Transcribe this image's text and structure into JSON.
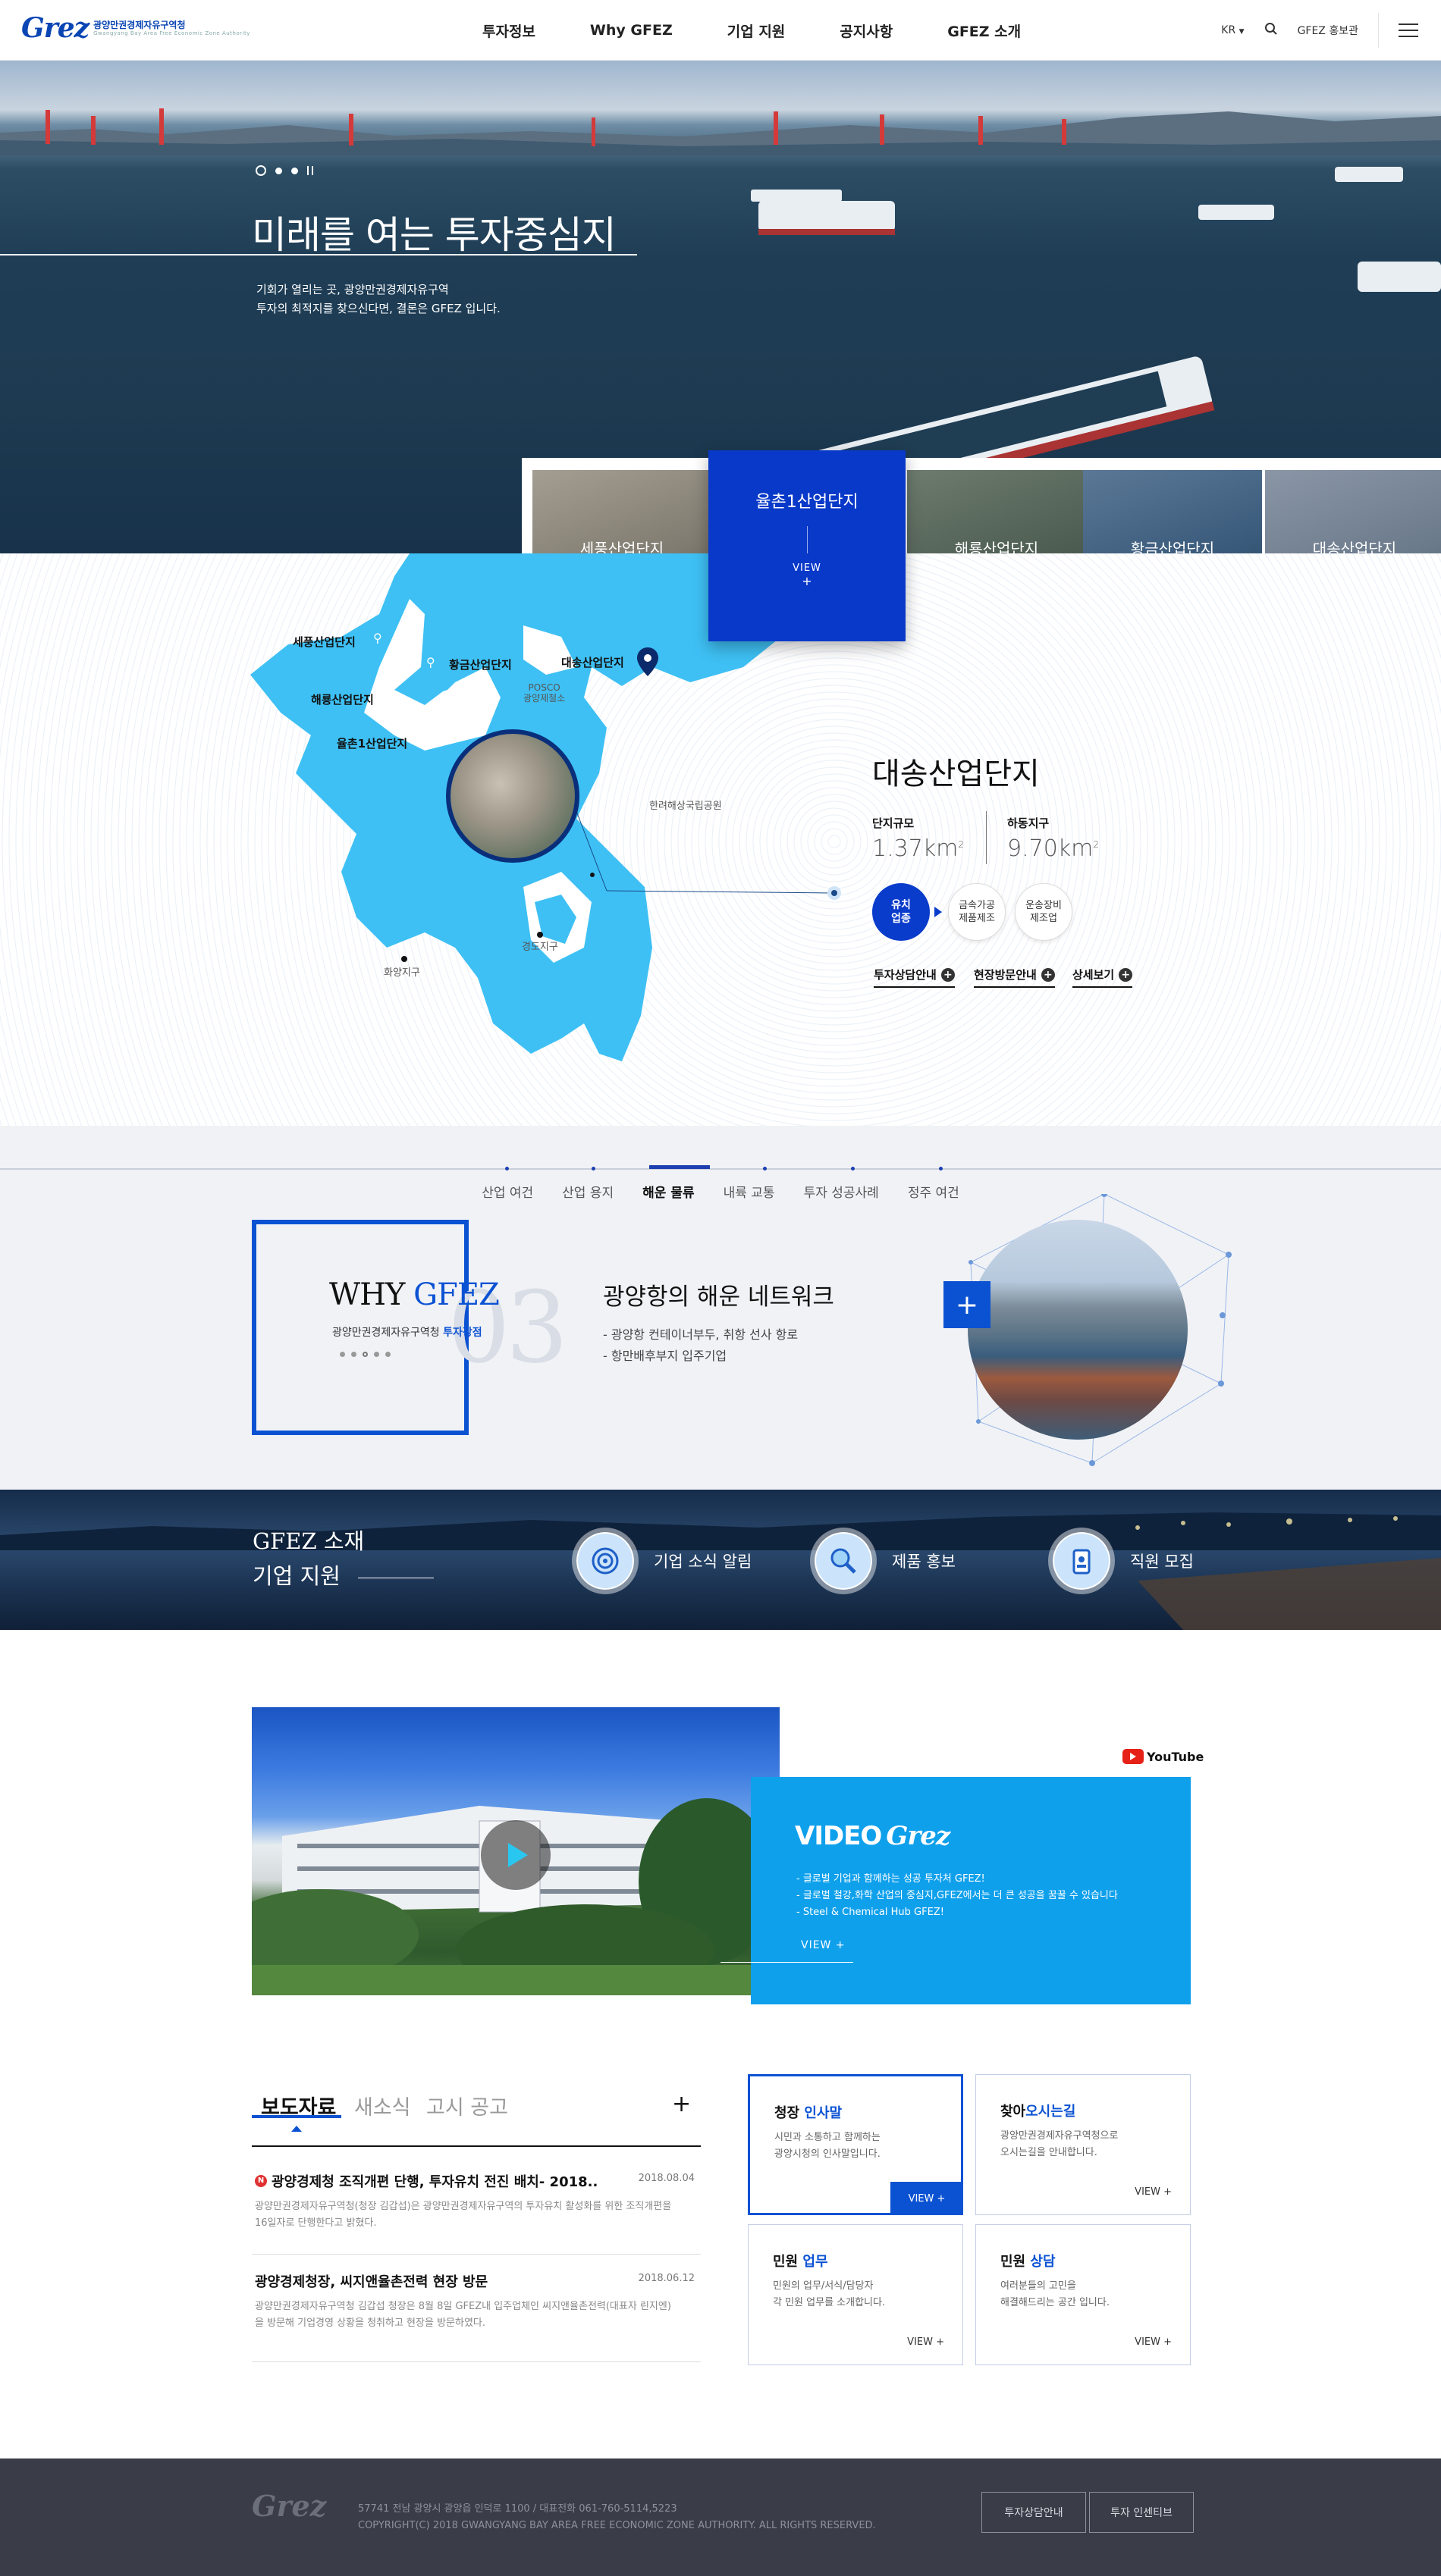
{
  "header": {
    "logo_word": "Grez",
    "logo_org": "광양만권경제자유구역청",
    "logo_org_en": "Gwangyang Bay Area Free Economic Zone Authority",
    "nav": [
      "투자정보",
      "Why GFEZ",
      "기업 지원",
      "공지사항",
      "GFEZ 소개"
    ],
    "lang": "KR",
    "pr_hall": "GFEZ 홍보관"
  },
  "hero": {
    "title": "미래를 여는 투자중심지",
    "desc_line1": "기회가 열리는 곳, 광양만권경제자유구역",
    "desc_line2": "투자의 최적지를 찾으신다면, 결론은 GFEZ 입니다."
  },
  "complexes": {
    "items": [
      "세풍산업단지",
      "율촌1산업단지",
      "해룡산업단지",
      "황금산업단지",
      "대송산업단지"
    ],
    "active_index": 1,
    "view_label": "VIEW",
    "view_plus": "+"
  },
  "map": {
    "pins": {
      "sepung": "세풍산업단지",
      "hwanggeum": "황금산업단지",
      "daesong": "대송산업단지",
      "haeryong": "해룡산업단지",
      "yulchon": "율촌1산업단지",
      "posco": "POSCO\n광양제철소",
      "hallyeo": "한려해상국립공원",
      "gwangyang": "화양지구",
      "gyeongdo": "경도지구"
    },
    "detail": {
      "title": "대송산업단지",
      "size_label": "단지규모",
      "size_value": "1.37km",
      "size_unit": "2",
      "dong_label": "하동지구",
      "dong_value": "9.70km",
      "dong_unit": "2",
      "main_industry": "유치\n업종",
      "industries": [
        "금속가공\n제품제조",
        "운송장비\n제조업"
      ],
      "links": [
        "투자상담안내",
        "현장방문안내",
        "상세보기"
      ]
    }
  },
  "why": {
    "tabs": [
      "산업 여건",
      "산업 용지",
      "해운 물류",
      "내륙 교통",
      "투자 성공사례",
      "정주 여건"
    ],
    "active_tab": 2,
    "title_a": "WHY ",
    "title_b": "GFEZ",
    "sub_a": "광양만권경제자유구역청 ",
    "sub_b": "투자강점",
    "number": "03",
    "heading": "광양항의 해운 네트워크",
    "list": [
      "- 광양항 컨테이너부두, 취항 선사 항로",
      "- 항만배후부지 입주기업"
    ],
    "plus": "+"
  },
  "support": {
    "title_line1": "GFEZ 소재",
    "title_line2": "기업 지원",
    "items": [
      "기업 소식 알림",
      "제품 홍보",
      "직원 모집"
    ]
  },
  "video": {
    "yt_label": "YouTube",
    "title": "VIDEO",
    "title_logo": "Grez",
    "list": [
      "- 글로벌 기업과 함께하는 성공 투자처 GFEZ!",
      "- 글로벌 철강,화학 산업의 중심지,GFEZ에서는 더 큰 성공을 꿈꿀 수 있습니다",
      "- Steel & Chemical Hub GFEZ!"
    ],
    "view": "VIEW  +"
  },
  "news": {
    "tabs": [
      "보도자료",
      "새소식",
      "고시 공고"
    ],
    "plus": "+",
    "items": [
      {
        "title": "광양경제청 조직개편 단행, 투자유치 전진 배치- 2018..",
        "date": "2018.08.04",
        "desc": "광양만권경제자유구역청(청장 김갑섭)은 광양만권경제자유구역의 투자유치 활성화를 위한 조직개편을 16일자로 단행한다고 밝혔다."
      },
      {
        "title": "광양경제청장, 씨지앤율촌전력 현장 방문",
        "date": "2018.06.12",
        "desc": "광양만권경제자유구역청 김갑섭 청장은 8월 8일 GFEZ내 입주업체인 씨지앤율촌전력(대표자 린지엔)을 방문해 기업경영 상황을 청취하고 현장을 방문하였다."
      }
    ]
  },
  "quick": [
    {
      "h_a": "청장 ",
      "h_b": "인사말",
      "p": "시민과 소통하고 함께하는\n광양시청의 인사말입니다.",
      "v": "VIEW  +"
    },
    {
      "h_a": "찾아",
      "h_b": "오시는길",
      "p": "광양만권경제자유구역청으로\n오시는길을 안내합니다.",
      "v": "VIEW  +"
    },
    {
      "h_a": "민원 ",
      "h_b": "업무",
      "p": "민원의 업무/서식/담당자\n각 민원 업무를 소개합니다.",
      "v": "VIEW  +"
    },
    {
      "h_a": "민원 ",
      "h_b": "상담",
      "p": "여러분들의 고민을\n해결해드리는 공간 입니다.",
      "v": "VIEW  +"
    }
  ],
  "footer": {
    "logo": "Grez",
    "address": "57741 전남 광양시 광양읍 인덕로 1100  /  대표전화 061-760-5114,5223",
    "copyright": "COPYRIGHT(C) 2018 GWANGYANG BAY AREA FREE ECONOMIC ZONE AUTHORITY. ALL RIGHTS RESERVED.",
    "btn1": "투자상담안내",
    "btn2": "투자 인센티브"
  },
  "colors": {
    "primary": "#0b52d3",
    "map_sea": "#3ec0f4",
    "video_blue": "#0fa0ec",
    "footer": "#3a3d48"
  }
}
